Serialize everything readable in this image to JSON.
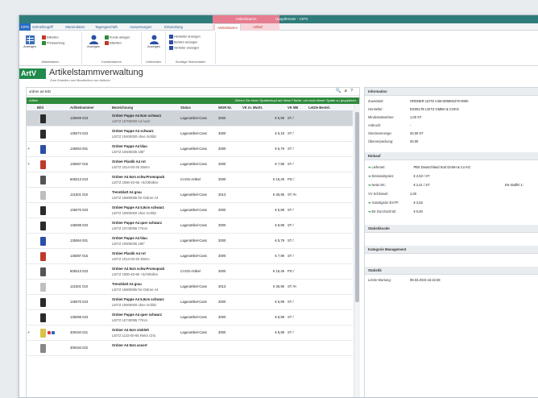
{
  "titlebar": {
    "title": "Hauptfenster - CIPS",
    "context_label": "Artikelstamm"
  },
  "menubar": {
    "file_tab": "CIPS",
    "tabs": [
      "Schnellzugriff",
      "Stammdaten",
      "Tagesgeschäft",
      "Auswertungen",
      "Entwicklung",
      "Artikelstamm",
      "Artikel"
    ]
  },
  "ribbon": {
    "groups": [
      {
        "label": "Artikelstamm",
        "big": "Anzeigen",
        "small": [
          "Etiketten",
          "Preiswartung"
        ]
      },
      {
        "label": "Kundenstamm",
        "big": "Anzeigen",
        "small": [
          "Kunde anlegen",
          "Etiketten"
        ]
      },
      {
        "label": "Lieferanten",
        "big": "Anzeigen"
      },
      {
        "label": "Sonstige Stammdaten",
        "small": [
          "Hersteller anzeigen",
          "Banken anzeigen",
          "Vertreter anzeigen"
        ]
      }
    ]
  },
  "page": {
    "logo": "ArtV",
    "title": "Artikelstammverwaltung",
    "subtitle": "Zum Erstellen und Bearbeiten von Artikeln"
  },
  "search": {
    "value": "ordner a4 leitz",
    "icons": [
      "search-icon",
      "clear-icon",
      "help-icon"
    ]
  },
  "grid": {
    "group_label": "Artikel",
    "group_hint": "Ziehen Sie einen Spaltenkopf auf diese Fläche, um nach dieser Spalte zu gruppieren.",
    "columns": [
      "Bild",
      "Artikelnummer",
      "Bezeichnung",
      "Status",
      "WGR Nr.",
      "VK m. MwSt.",
      "VK ME",
      "Letzte Bestel."
    ],
    "rows": [
      {
        "num": "135069 023",
        "b1": "Ordner Pappe A4 8cm schwarz",
        "b2": "LEITZ 10700000 A4 hoch",
        "status": "Lagerartikel-Cass",
        "wgr": "3000",
        "price": "€ 5,99",
        "vk": "ST /",
        "color": "#2b2b2b",
        "sel": true
      },
      {
        "num": "135074 023",
        "b1": "Ordner Pappe A4 schwarz",
        "b2": "LEITZ 10400000 ohne Schlitz",
        "status": "Lagerartikel-Cass",
        "wgr": "3000",
        "price": "€ 6,19",
        "vk": "ST /",
        "color": "#2b2b2b"
      },
      {
        "num": "135064 001",
        "b1": "Ordner Pappe A4 blau",
        "b2": "LEITZ 10505035 180°",
        "status": "Lagerartikel-Cass",
        "wgr": "3000",
        "price": "€ 5,79",
        "vk": "ST /",
        "color": "#2b4fa8",
        "exp": "+"
      },
      {
        "num": "135087 015",
        "b1": "Ordner Plastik A4 rot",
        "b2": "LEITZ 1014-00-25 35mm",
        "status": "Lagerartikel-Cass",
        "wgr": "3000",
        "price": "€ 7,99",
        "vk": "ST /",
        "color": "#c0392b",
        "exp": "+"
      },
      {
        "num": "608313 023",
        "b1": "Ordner A4 8cm schw.Promopack",
        "b2": "LEITZ 1080-40-95 +Schthüllen",
        "status": "CAOS-Artikel",
        "wgr": "3000",
        "price": "€ 15,49",
        "vk": "PG /",
        "color": "#555555"
      },
      {
        "num": "121501 010",
        "b1": "Trennblatt A4 grau",
        "b2": "LEITZ 16600085 für Ordner A4",
        "status": "Lagerartikel-Cass",
        "wgr": "3013",
        "price": "€ 35,95",
        "vk": "ST /H",
        "color": "#bfbfbf"
      },
      {
        "num": "135070 023",
        "b1": "Ordner Pappe A4 5,9cm schwarz",
        "b2": "LEITZ 10600000 ohne Schlitz",
        "status": "Lagerartikel-Cass",
        "wgr": "3000",
        "price": "€ 5,99",
        "vk": "ST /",
        "color": "#2b2b2b"
      },
      {
        "num": "135098 023",
        "b1": "Ordner Pappe A4 quer schwarz",
        "b2": "LEITZ 10740095 77mm",
        "status": "Lagerartikel-Cass",
        "wgr": "3000",
        "price": "€ 8,99",
        "vk": "ST /",
        "color": "#2b2b2b"
      },
      {
        "num": "135064 001",
        "b1": "Ordner Pappe A4 blau",
        "b2": "LEITZ 10505035 180°",
        "status": "Lagerartikel-Cass",
        "wgr": "3000",
        "price": "€ 5,79",
        "vk": "ST /",
        "color": "#2b4fa8"
      },
      {
        "num": "135087 015",
        "b1": "Ordner Plastik A4 rot",
        "b2": "LEITZ 1014-00-25 35mm",
        "status": "Lagerartikel-Cass",
        "wgr": "3000",
        "price": "€ 7,99",
        "vk": "ST /",
        "color": "#c0392b"
      },
      {
        "num": "608313 023",
        "b1": "Ordner A4 8cm schw.Promopack",
        "b2": "LEITZ 1080-40-95 +Schthüllen",
        "status": "CAOS-Artikel",
        "wgr": "3000",
        "price": "€ 15,49",
        "vk": "PG /",
        "color": "#555555"
      },
      {
        "num": "121501 010",
        "b1": "Trennblatt A4 grau",
        "b2": "LEITZ 16600085 für Ordner A4",
        "status": "Lagerartikel-Cass",
        "wgr": "3013",
        "price": "€ 35,95",
        "vk": "ST /H",
        "color": "#bfbfbf"
      },
      {
        "num": "135070 023",
        "b1": "Ordner Pappe A4 5,9cm schwarz",
        "b2": "LEITZ 10600000 ohne Schlitz",
        "status": "Lagerartikel-Cass",
        "wgr": "3000",
        "price": "€ 5,99",
        "vk": "ST /",
        "color": "#2b2b2b"
      },
      {
        "num": "135098 023",
        "b1": "Ordner Pappe A4 quer schwarz",
        "b2": "LEITZ 10740095 77mm",
        "status": "Lagerartikel-Cass",
        "wgr": "3000",
        "price": "€ 8,99",
        "vk": "ST /",
        "color": "#2b2b2b"
      },
      {
        "num": "308194 021",
        "b1": "Ordner A4 8cm stoklett",
        "b2": "LEITZ 1133-00-65 Retro Chic",
        "status": "Lagerartikel-Cass",
        "wgr": "3000",
        "price": "€ 8,99",
        "vk": "ST /",
        "color": "#d8c24a",
        "exp": "+",
        "flags": true
      },
      {
        "num": "308194 022",
        "b1": "Ordner A4 8cm assort",
        "b2": "",
        "status": "",
        "wgr": "",
        "price": "",
        "vk": "",
        "color": "#888888"
      }
    ]
  },
  "info": {
    "sections": {
      "information": "Information",
      "einkauf": "Einkauf",
      "statistikcode": "Statistikcode",
      "kategorie": "Kategorie Management",
      "statistik": "Statistik"
    },
    "information_rows": [
      {
        "k": "Zuweisteit:",
        "v": "ORDNER LEITZ A4M 8OMM1070-0000"
      },
      {
        "k": "Hersteller:",
        "v": "ESSELTE LEITZ GMBH & COKG"
      },
      {
        "k": "Mindestabnahme:",
        "v": "1,00 ST"
      },
      {
        "k": "Anbruch:",
        "v": "-"
      },
      {
        "k": "Streckenmenge:",
        "v": "20,00 ST"
      },
      {
        "k": "Überverpackung:",
        "v": "20,00"
      }
    ],
    "einkauf_rows": [
      {
        "k": "Lieferant:",
        "v": "PBS Deutschland Süd GmbH & Co KG",
        "icon": true
      },
      {
        "k": "Einstandspreis:",
        "v": "€ 2,53 / ST",
        "icon": true
      },
      {
        "k": "Netto EK:",
        "v": "€ 2,41 / ST",
        "icon": true,
        "extra": "EK-Staffel 1:"
      },
      {
        "k": "VV Schlüssel:",
        "v": "1,00",
        "icon": false
      },
      {
        "k": "Günstigster ESTP:",
        "v": "€ 2,53",
        "icon": true
      },
      {
        "k": "EK Durchschnitt:",
        "v": "€ 0,00",
        "icon": true
      }
    ],
    "statistik_rows": [
      {
        "k": "Letzte Wartung:",
        "v": "09.03.2015 15:22:28"
      }
    ]
  }
}
